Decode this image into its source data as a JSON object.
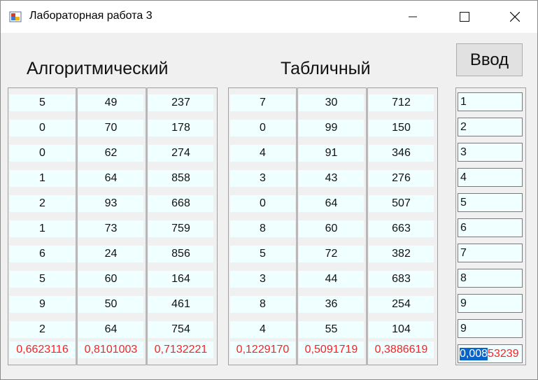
{
  "window": {
    "title": "Лабораторная работа 3"
  },
  "headings": {
    "algorithmic": "Алгоритмический",
    "table": "Табличный"
  },
  "input_button": "Ввод",
  "algorithmic": {
    "columns": [
      {
        "values": [
          "5",
          "0",
          "0",
          "1",
          "2",
          "1",
          "6",
          "5",
          "9",
          "2"
        ],
        "result": "0,6623116"
      },
      {
        "values": [
          "49",
          "70",
          "62",
          "64",
          "93",
          "73",
          "24",
          "60",
          "50",
          "64"
        ],
        "result": "0,8101003"
      },
      {
        "values": [
          "237",
          "178",
          "274",
          "858",
          "668",
          "759",
          "856",
          "164",
          "461",
          "754"
        ],
        "result": "0,7132221"
      }
    ]
  },
  "table": {
    "columns": [
      {
        "values": [
          "7",
          "0",
          "4",
          "3",
          "0",
          "8",
          "5",
          "3",
          "8",
          "4"
        ],
        "result": "0,1229170"
      },
      {
        "values": [
          "30",
          "99",
          "91",
          "43",
          "64",
          "60",
          "72",
          "44",
          "36",
          "55"
        ],
        "result": "0,5091719"
      },
      {
        "values": [
          "712",
          "150",
          "346",
          "276",
          "507",
          "663",
          "382",
          "683",
          "254",
          "104"
        ],
        "result": "0,3886619"
      }
    ]
  },
  "inputs": {
    "values": [
      "1",
      "2",
      "3",
      "4",
      "5",
      "6",
      "7",
      "8",
      "9",
      "9"
    ],
    "result": {
      "selected_part": "0,008",
      "rest": "53239"
    }
  }
}
